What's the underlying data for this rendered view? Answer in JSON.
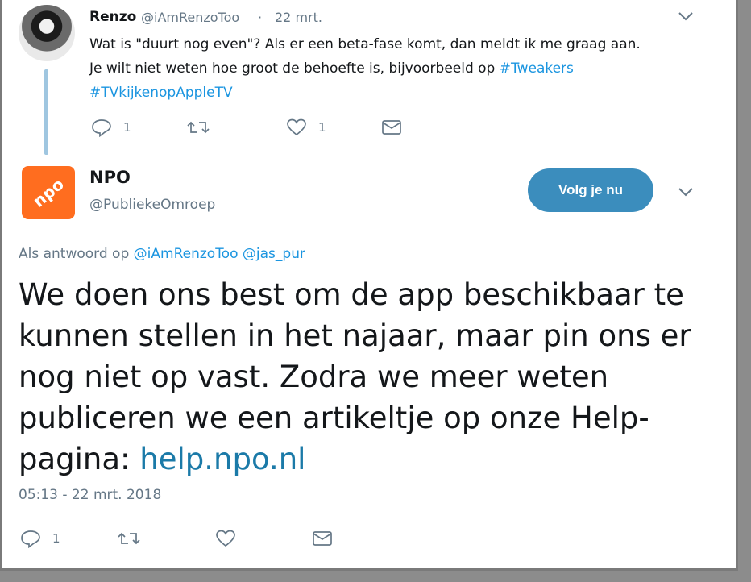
{
  "reply_tweet": {
    "display_name": "Renzo",
    "handle": "@iAmRenzoToo",
    "separator": "·",
    "date": "22 mrt.",
    "text_line1": "Wat is \"duurt nog even\"? Als er een beta-fase komt, dan meldt ik me graag aan.",
    "text_line2_prefix": "Je wilt niet weten hoe groot de behoefte is, bijvoorbeeld op ",
    "hashtag1": "#Tweakers",
    "hashtag2": "#TVkijkenopAppleTV",
    "reply_count": "1",
    "like_count": "1"
  },
  "main_tweet": {
    "display_name": "NPO",
    "handle": "@PubliekeOmroep",
    "follow_label": "Volg je nu",
    "reply_prefix": "Als antwoord op ",
    "reply_mention1": "@iAmRenzoToo",
    "reply_mention2": "@jas_pur",
    "text_line1": "We doen ons best om de app beschikbaar te",
    "text_line2": "kunnen stellen in het najaar, maar pin ons er",
    "text_line3": "nog niet op vast. Zodra we meer weten",
    "text_line4": "publiceren we een artikeltje op onze Help-",
    "text_line5_prefix": "pagina: ",
    "link": "help.npo.nl",
    "timestamp": "05:13 - 22 mrt. 2018",
    "reply_count": "1",
    "logo_text": "npo"
  },
  "colors": {
    "link": "#1b95e0",
    "follow_button": "#3b8dbd",
    "npo_orange": "#ff6d1f",
    "thread_line": "#9fc6e0"
  }
}
